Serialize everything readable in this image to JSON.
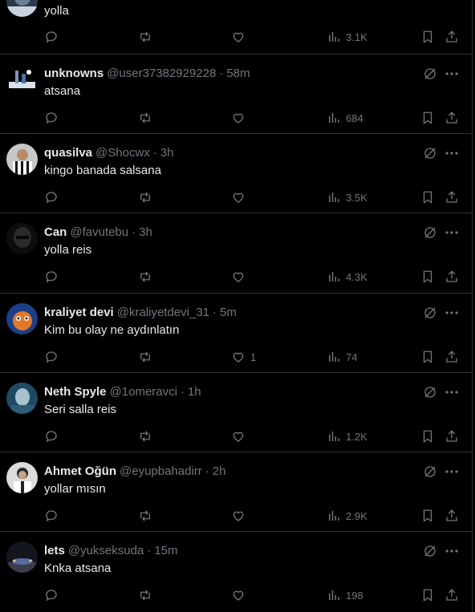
{
  "tweets": [
    {
      "name": "",
      "handle": "",
      "time": "",
      "text": "yolla",
      "likes": "",
      "views": "3.1K",
      "avatar": "partial-photo"
    },
    {
      "name": "unknowns",
      "handle": "@user37382929228",
      "time": "58m",
      "text": "atsana",
      "likes": "",
      "views": "684",
      "avatar": "skyline-photo"
    },
    {
      "name": "quasilva",
      "handle": "@Shocwx",
      "time": "3h",
      "text": "kingo banada salsana",
      "likes": "",
      "views": "3.5K",
      "avatar": "footballer-striped-shirt"
    },
    {
      "name": "Can",
      "handle": "@favutebu",
      "time": "3h",
      "text": "yolla reis",
      "likes": "",
      "views": "4.3K",
      "avatar": "dark-helmet"
    },
    {
      "name": "kraliyet devi",
      "handle": "@kraliyetdevi_31",
      "time": "5m",
      "text": "Kim bu olay ne aydınlatın",
      "likes": "1",
      "views": "74",
      "avatar": "cartoon-character"
    },
    {
      "name": "Neth Spyle",
      "handle": "@1omeravci",
      "time": "1h",
      "text": "Seri salla reis",
      "likes": "",
      "views": "1.2K",
      "avatar": "blue-portrait"
    },
    {
      "name": "Ahmet Oğün",
      "handle": "@eyupbahadirr",
      "time": "2h",
      "text": "yollar mısın",
      "likes": "",
      "views": "2.9K",
      "avatar": "man-white-shirt"
    },
    {
      "name": "lets",
      "handle": "@yukseksuda",
      "time": "15m",
      "text": "Knka atsana",
      "likes": "",
      "views": "198",
      "avatar": "car-night"
    }
  ],
  "colors": {
    "background": "#000000",
    "text": "#e7e9ea",
    "muted": "#71767b",
    "divider": "#2f3336"
  }
}
